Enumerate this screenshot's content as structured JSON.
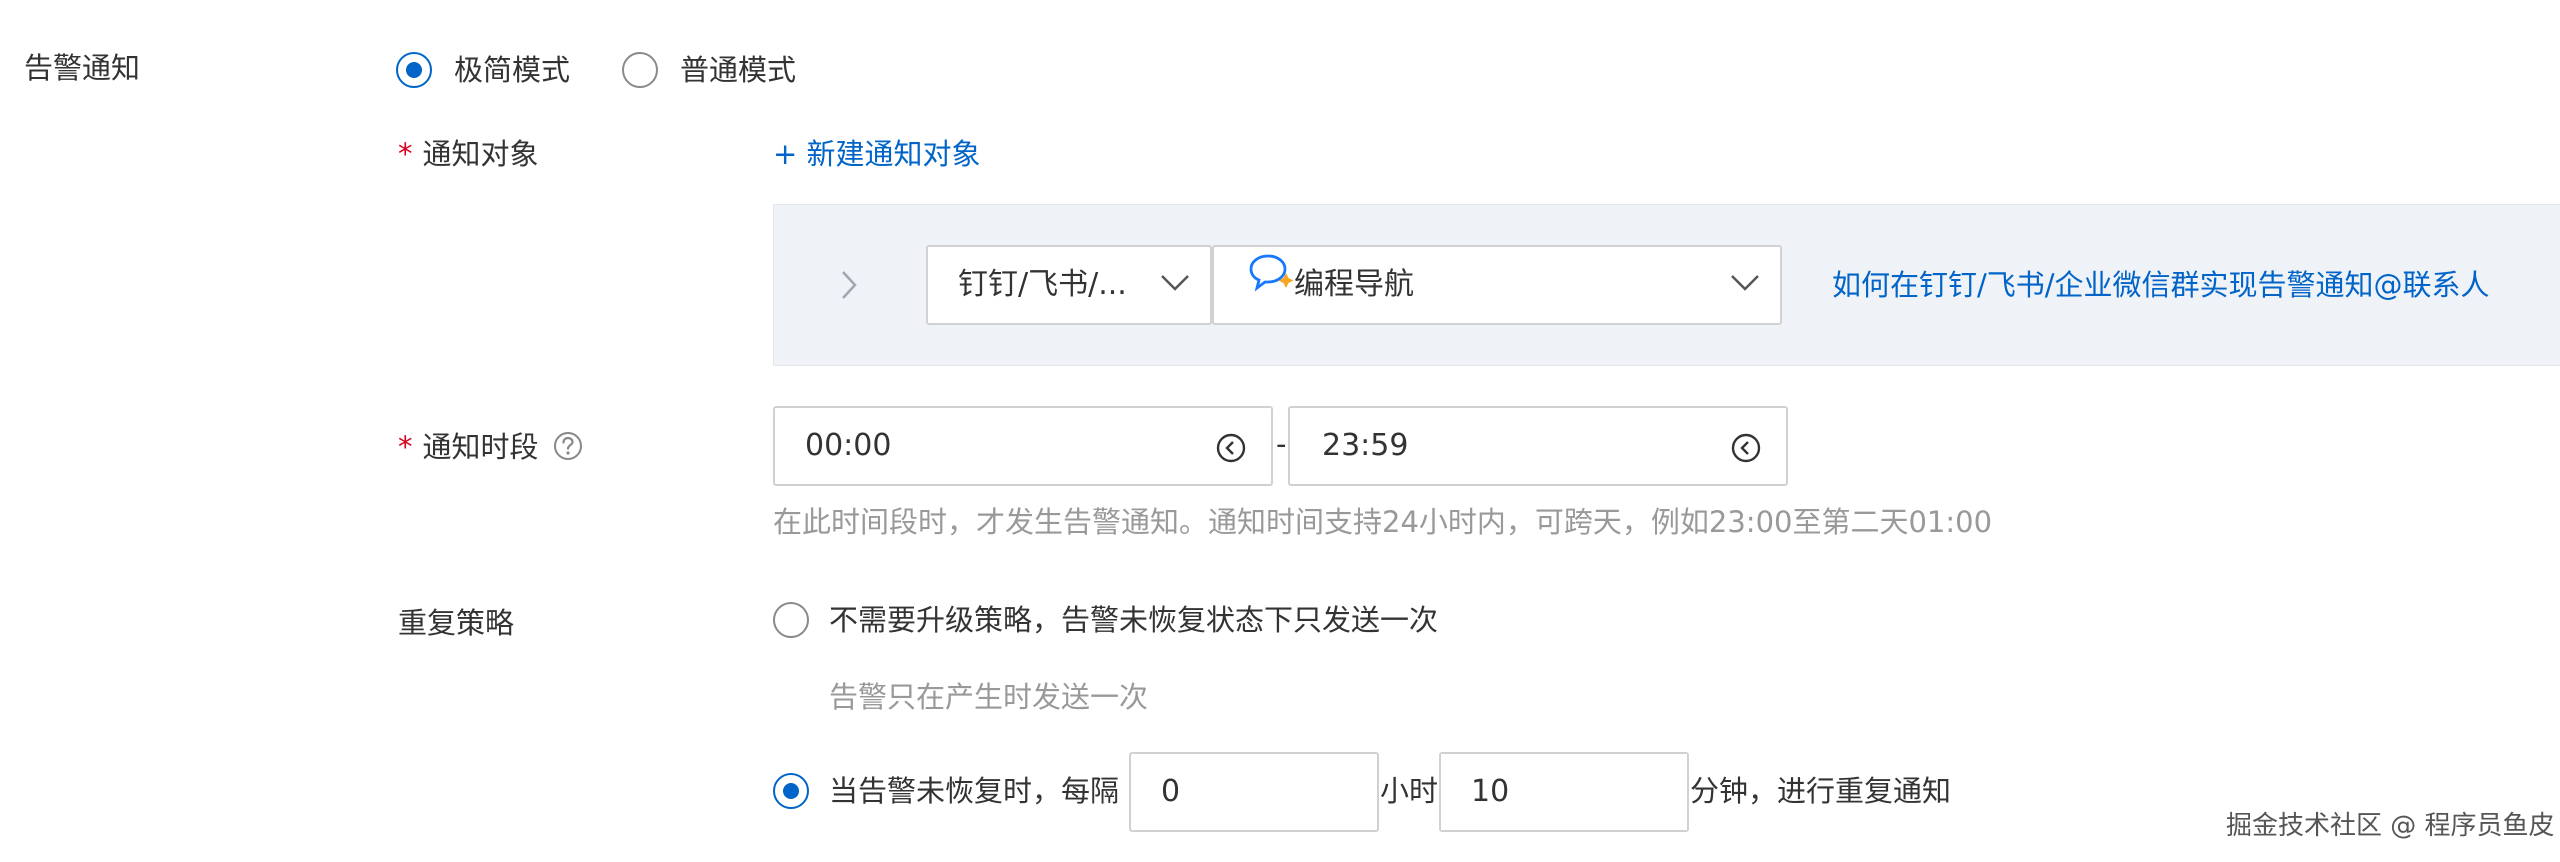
{
  "section": {
    "title": "告警通知"
  },
  "mode": {
    "options": [
      {
        "label": "极简模式",
        "checked": true
      },
      {
        "label": "普通模式",
        "checked": false
      }
    ]
  },
  "notify_target": {
    "label": "通知对象",
    "required_mark": "*",
    "add_link": "+ 新建通知对象",
    "channel_select": "钉钉/飞书/...",
    "group_select": "编程导航",
    "help_link": "如何在钉钉/飞书/企业微信群实现告警通知@联系人"
  },
  "notify_time": {
    "label": "通知时段",
    "required_mark": "*",
    "start": "00:00",
    "separator": "-",
    "end": "23:59",
    "hint": "在此时间段时，才发生告警通知。通知时间支持24小时内，可跨天，例如23:00至第二天01:00"
  },
  "repeat": {
    "label": "重复策略",
    "option_once": {
      "label": "不需要升级策略，告警未恢复状态下只发送一次",
      "checked": false,
      "desc": "告警只在产生时发送一次"
    },
    "option_repeat": {
      "checked": true,
      "prefix": "当告警未恢复时，每隔",
      "hours": "0",
      "hours_unit": "小时",
      "minutes": "10",
      "suffix": "分钟，进行重复通知"
    }
  },
  "watermark": "掘金技术社区 @ 程序员鱼皮",
  "colors": {
    "accent": "#0064c8",
    "required": "#d9001b",
    "panel": "#eff2f6"
  }
}
